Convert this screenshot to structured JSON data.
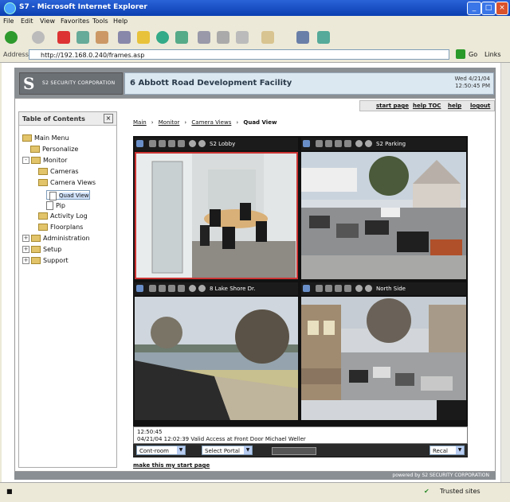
{
  "window": {
    "title": "S7 - Microsoft Internet Explorer"
  },
  "menu": [
    "File",
    "Edit",
    "View",
    "Favorites",
    "Tools",
    "Help"
  ],
  "address": {
    "label": "Address",
    "url": "http://192.168.0.240/frames.asp",
    "go": "Go",
    "links": "Links"
  },
  "header": {
    "logo_letter": "S",
    "logo_text": "S2 SECURITY CORPORATION",
    "facility": "6 Abbott Road Development Facility",
    "date": "Wed 4/21/04",
    "time": "12:50:45 PM"
  },
  "toplinks": [
    "start page",
    "help TOC",
    "help",
    "logout"
  ],
  "toc": {
    "title": "Table of Contents",
    "items": [
      {
        "label": "Main Menu",
        "level": 0
      },
      {
        "label": "Personalize",
        "level": 1
      },
      {
        "label": "Monitor",
        "level": 1
      },
      {
        "label": "Cameras",
        "level": 2
      },
      {
        "label": "Camera Views",
        "level": 2
      },
      {
        "label": "Quad View",
        "level": 3
      },
      {
        "label": "Pip",
        "level": 3
      },
      {
        "label": "Activity Log",
        "level": 2
      },
      {
        "label": "Floorplans",
        "level": 2
      },
      {
        "label": "Administration",
        "level": 1
      },
      {
        "label": "Setup",
        "level": 1
      },
      {
        "label": "Support",
        "level": 1
      }
    ]
  },
  "breadcrumb": [
    "Main",
    "Monitor",
    "Camera Views",
    "Quad View"
  ],
  "cameras": [
    {
      "name": "S2 Lobby"
    },
    {
      "name": "S2 Parking"
    },
    {
      "name": "8 Lake Shore Dr."
    },
    {
      "name": "North Side"
    }
  ],
  "log": {
    "line1": "12:50:45",
    "line2": "04/21/04 12:02:39 Valid Access at Front Door Michael Weller"
  },
  "controls": {
    "camera_select": "Cont-room",
    "portal_select": "Select Portal",
    "mode_select": "Recal"
  },
  "start_link": "make this my start page",
  "footer": "powered by S2 SECURITY CORPORATION",
  "status": {
    "zone": "Trusted sites"
  }
}
